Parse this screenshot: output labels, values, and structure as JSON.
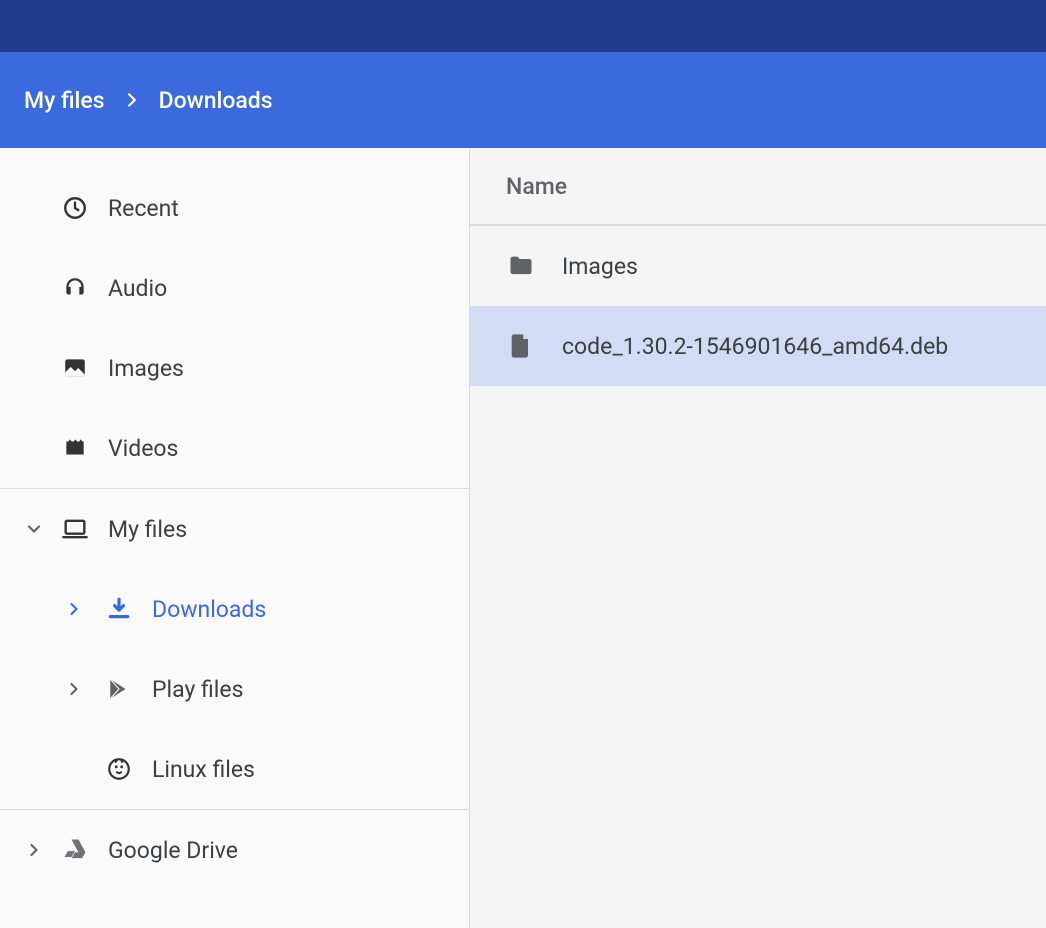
{
  "breadcrumb": {
    "root": "My files",
    "current": "Downloads"
  },
  "sidebar": {
    "quick": [
      {
        "label": "Recent"
      },
      {
        "label": "Audio"
      },
      {
        "label": "Images"
      },
      {
        "label": "Videos"
      }
    ],
    "myfiles": {
      "label": "My files",
      "children": [
        {
          "label": "Downloads",
          "active": true
        },
        {
          "label": "Play files"
        },
        {
          "label": "Linux files"
        }
      ]
    },
    "drive": {
      "label": "Google Drive"
    }
  },
  "content": {
    "column_header": "Name",
    "rows": [
      {
        "name": "Images",
        "type": "folder",
        "selected": false
      },
      {
        "name": "code_1.30.2-1546901646_amd64.deb",
        "type": "file",
        "selected": true
      }
    ]
  }
}
